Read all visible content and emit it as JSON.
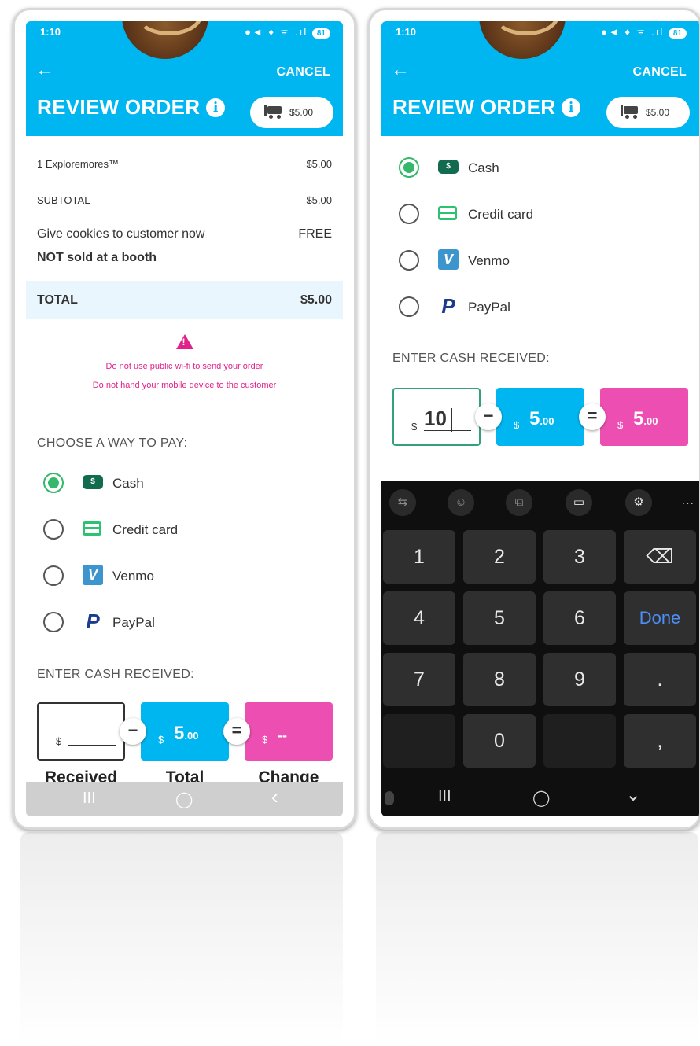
{
  "status_bar": {
    "time": "1:10",
    "icons": "●◄ ♦ ᯤ .ıl",
    "battery": "81"
  },
  "header": {
    "back_glyph": "←",
    "cancel_label": "CANCEL",
    "title": "REVIEW ORDER",
    "info_glyph": "i",
    "cart_total": "$5.00"
  },
  "order": {
    "item": {
      "label": "1 Exploremores™",
      "amount": "$5.00"
    },
    "subtotal": {
      "label": "SUBTOTAL",
      "amount": "$5.00"
    },
    "delivery": {
      "label": "Give cookies to customer now",
      "amount": "FREE"
    },
    "booth_note": "NOT sold at a booth",
    "total": {
      "label": "TOTAL",
      "amount": "$5.00"
    }
  },
  "warning": {
    "line1": "Do not use public wi-fi to send your order",
    "line2": "Do not hand your mobile device to the customer"
  },
  "payment": {
    "section_label": "CHOOSE A WAY TO PAY:",
    "selected": "cash",
    "options": [
      {
        "id": "cash",
        "label": "Cash",
        "icon": "cash-icon",
        "icon_glyph": "$"
      },
      {
        "id": "credit",
        "label": "Credit card",
        "icon": "credit-card-icon",
        "icon_glyph": ""
      },
      {
        "id": "venmo",
        "label": "Venmo",
        "icon": "venmo-icon",
        "icon_glyph": "V"
      },
      {
        "id": "paypal",
        "label": "PayPal",
        "icon": "paypal-icon",
        "icon_glyph": "P"
      }
    ]
  },
  "cash_entry": {
    "section_label": "ENTER CASH RECEIVED:",
    "currency": "$",
    "received_value_left": "",
    "received_value_right": "10",
    "total_whole": "5",
    "total_cents": ".00",
    "change_left": "--",
    "change_right_whole": "5",
    "change_right_cents": ".00",
    "minus_glyph": "−",
    "equals_glyph": "=",
    "captions": {
      "received": "Received",
      "total": "Total",
      "change": "Change"
    }
  },
  "keyboard": {
    "tools": [
      "⇆",
      "☺",
      "⧉",
      "▭",
      "⚙"
    ],
    "more": "...",
    "rows": [
      [
        "1",
        "2",
        "3",
        "⌫"
      ],
      [
        "4",
        "5",
        "6",
        "Done"
      ],
      [
        "7",
        "8",
        "9",
        "."
      ],
      [
        "",
        "0",
        "",
        ","
      ]
    ]
  },
  "nav": {
    "recents": "III",
    "home": "◯",
    "back": "‹",
    "hide_keyboard": "⌄"
  },
  "colors": {
    "brand_blue": "#00b6f0",
    "change_pink": "#ec4fb1",
    "radio_green": "#35b86b",
    "warning_pink": "#e0228a"
  }
}
